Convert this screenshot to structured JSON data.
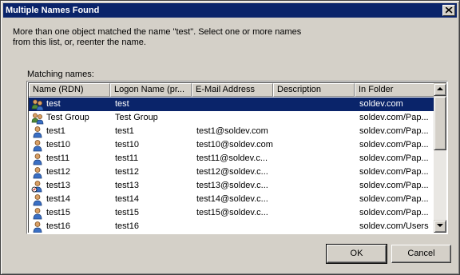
{
  "window": {
    "title": "Multiple Names Found"
  },
  "description": {
    "line1": "More than one object matched the name \"test\". Select one or more names",
    "line2": "from this list, or, reenter the name."
  },
  "list": {
    "label": "Matching names:",
    "columns": [
      "Name (RDN)",
      "Logon Name (pr...",
      "E-Mail Address",
      "Description",
      "In Folder"
    ],
    "rows": [
      {
        "icon": "group-icon",
        "name": "test",
        "logon": "test",
        "email": "",
        "description": "",
        "folder": "soldev.com",
        "selected": true
      },
      {
        "icon": "group-icon",
        "name": "Test Group",
        "logon": "Test Group",
        "email": "",
        "description": "",
        "folder": "soldev.com/Pap..."
      },
      {
        "icon": "user-icon",
        "name": "test1",
        "logon": "test1",
        "email": "test1@soldev.com",
        "description": "",
        "folder": "soldev.com/Pap..."
      },
      {
        "icon": "user-icon",
        "name": "test10",
        "logon": "test10",
        "email": "test10@soldev.com",
        "description": "",
        "folder": "soldev.com/Pap..."
      },
      {
        "icon": "user-icon",
        "name": "test11",
        "logon": "test11",
        "email": "test11@soldev.c...",
        "description": "",
        "folder": "soldev.com/Pap..."
      },
      {
        "icon": "user-icon",
        "name": "test12",
        "logon": "test12",
        "email": "test12@soldev.c...",
        "description": "",
        "folder": "soldev.com/Pap..."
      },
      {
        "icon": "user-disabled-icon",
        "name": "test13",
        "logon": "test13",
        "email": "test13@soldev.c...",
        "description": "",
        "folder": "soldev.com/Pap..."
      },
      {
        "icon": "user-icon",
        "name": "test14",
        "logon": "test14",
        "email": "test14@soldev.c...",
        "description": "",
        "folder": "soldev.com/Pap..."
      },
      {
        "icon": "user-icon",
        "name": "test15",
        "logon": "test15",
        "email": "test15@soldev.c...",
        "description": "",
        "folder": "soldev.com/Pap..."
      },
      {
        "icon": "user-icon",
        "name": "test16",
        "logon": "test16",
        "email": "",
        "description": "",
        "folder": "soldev.com/Users"
      }
    ]
  },
  "buttons": {
    "ok": "OK",
    "cancel": "Cancel"
  },
  "colors": {
    "titlebar": "#0a246a",
    "selection": "#0a246a",
    "face": "#d4d0c8"
  }
}
